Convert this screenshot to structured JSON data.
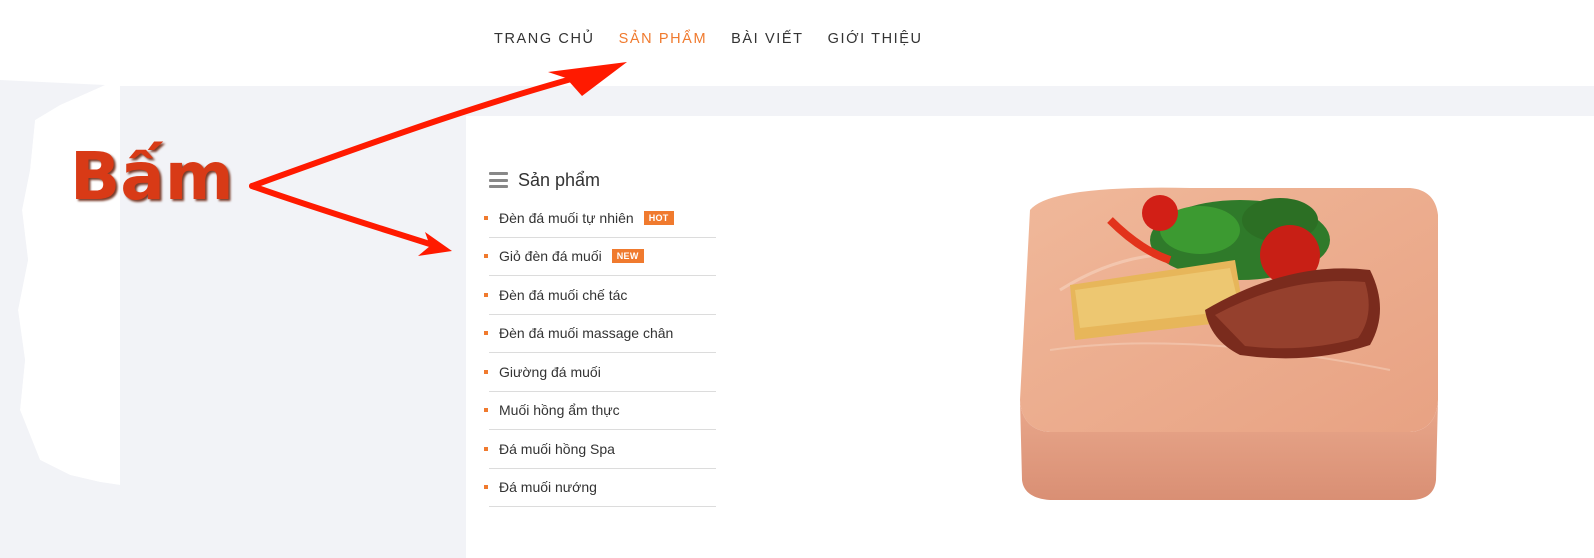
{
  "nav": {
    "items": [
      {
        "label": "TRANG CHỦ",
        "active": false
      },
      {
        "label": "SẢN PHẨM",
        "active": true
      },
      {
        "label": "BÀI VIẾT",
        "active": false
      },
      {
        "label": "GIỚI THIỆU",
        "active": false
      }
    ]
  },
  "sidebar": {
    "title": "Sản phẩm",
    "items": [
      {
        "label": "Đèn đá muối tự nhiên",
        "badge": "HOT"
      },
      {
        "label": "Giỏ đèn đá muối",
        "badge": "NEW"
      },
      {
        "label": "Đèn đá muối chế tác"
      },
      {
        "label": "Đèn đá muối massage chân"
      },
      {
        "label": "Giường đá muối"
      },
      {
        "label": "Muối hồng ẩm thực"
      },
      {
        "label": "Đá muối hồng Spa"
      },
      {
        "label": "Đá muối nướng"
      }
    ]
  },
  "annotation": {
    "text": "Bấm"
  },
  "colors": {
    "accent": "#f07a2e",
    "annotation": "#d83a16",
    "arrow": "#ff1a00",
    "band": "#f2f3f7"
  },
  "icons": {
    "menu": "hamburger-icon"
  }
}
